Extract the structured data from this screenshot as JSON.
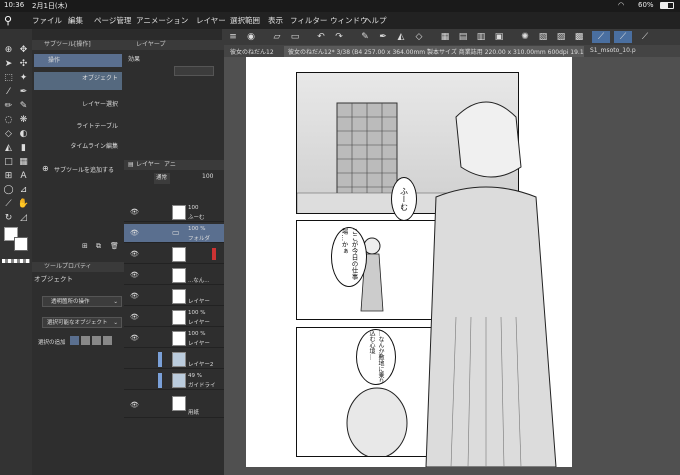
{
  "status": {
    "time": "10:36",
    "date": "2月1日(木)",
    "battery": "60%"
  },
  "menu": [
    "ファイル",
    "編集",
    "ページ管理",
    "アニメーション",
    "レイヤー",
    "選択範囲",
    "表示",
    "フィルター",
    "ウィンドウ",
    "ヘルプ"
  ],
  "subtool": {
    "header": "サブツール[操作]",
    "items": [
      "操作",
      "オブジェクト",
      "レイヤー選択",
      "ライトテーブル",
      "タイムライン編集"
    ],
    "selected": "オブジェクト",
    "add_label": "サブツールを追加する"
  },
  "layer_prop": {
    "header": "レイヤープ",
    "effect_label": "効果"
  },
  "toolprop": {
    "header": "ツールプロパティ",
    "title": "オブジェクト",
    "row1": "透明箇所の操作",
    "row2": "選択可能なオブジェクト",
    "row3": "選択の追加"
  },
  "layers": {
    "tab1": "レイヤー",
    "tab2": "アニ",
    "blend": "通常",
    "opacity": "100",
    "rows": [
      {
        "pct": "100",
        "name": "ふーむ"
      },
      {
        "pct": "100 %",
        "name": "フォルダ"
      },
      {
        "pct": "",
        "name": ""
      },
      {
        "pct": "",
        "name": "...なん..."
      },
      {
        "pct": "",
        "name": "レイヤー"
      },
      {
        "pct": "100 %",
        "name": "レイヤー"
      },
      {
        "pct": "100 %",
        "name": "レイヤー"
      },
      {
        "pct": "",
        "name": "レイヤー2"
      },
      {
        "pct": "49 %",
        "name": "ガイドライ"
      },
      {
        "pct": "",
        "name": "用紙"
      }
    ]
  },
  "tabs": [
    "彼女のねだん12",
    "彼女のねだん12* 3/38 (B4 257.00 x 364.00mm 製本サイズ 商業誌用 220.00 x 310.00mm 600dpi 19.1%)",
    "S1_msoto_10.p"
  ],
  "manga": {
    "bubble1": "ふーむ",
    "bubble2": "ここが今日の仕事場…かぁ",
    "bubble3": "…なんか敷地に乗り込む心境…"
  },
  "colors": {
    "accent": "#5a6f8f",
    "panel_bg": "#2e2e2e"
  }
}
